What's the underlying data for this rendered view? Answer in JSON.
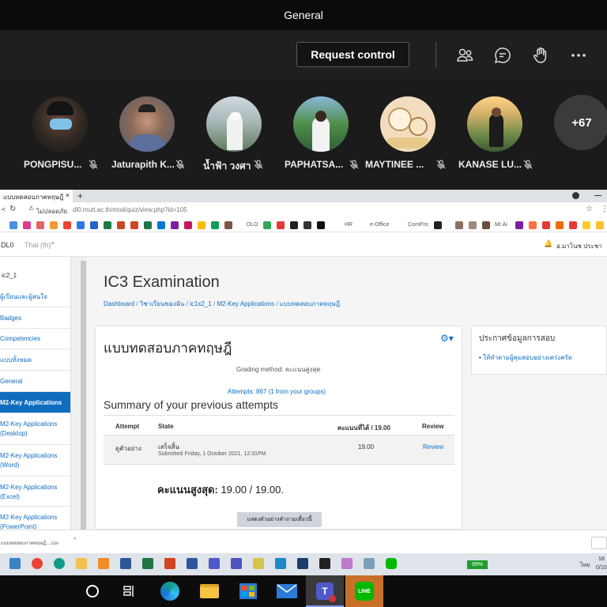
{
  "teams": {
    "title": "General",
    "request_control": "Request control",
    "participants": [
      {
        "name": "PONGPISU..."
      },
      {
        "name": "Jaturapith K..."
      },
      {
        "name": "น้ำฟ้า วงศา"
      },
      {
        "name": "PAPHATSA..."
      },
      {
        "name": "MAYTINEE ..."
      },
      {
        "name": "KANASE LU..."
      }
    ],
    "more_count": "+67"
  },
  "browser": {
    "tab_title": "แบบทดสอบภาคทฤษฎี",
    "new_tab": "+",
    "not_secure": "ไม่ปลอดภัย",
    "url": "dl0.mutt.ac.th/mod/quiz/view.php?id=105",
    "bookmark_labels": [
      "DLO",
      "HR",
      "e-Office",
      "ComPro",
      "Mr.Ai"
    ]
  },
  "moodle": {
    "site": "DL0",
    "language": "Thai (th)",
    "user": "อ.มาโนช ประชา",
    "course_title": "IC3 Examination",
    "breadcrumb": [
      "Dashboard",
      "วิชาเรียนของฉัน",
      "ic1x2_1",
      "M2-Key Applications",
      "แบบทดสอบภาคทฤษฎี"
    ],
    "sidebar": [
      "ic2_1",
      "ผู้เรียนและผู้สนใจ",
      "Badges",
      "Competencies",
      "แบบทั้งหมด",
      "General",
      "M2-Key Applications",
      "M2-Key Applications (Desktop)",
      "M2-Key Applications (Word)",
      "M2-Key Applications (Excel)",
      "M2-Key Applications (PowerPoint)"
    ],
    "quiz_title": "แบบทดสอบภาคทฤษฎี",
    "grading_method": "Grading method: คะแนนสูงสุด",
    "attempts": "Attempts: 867 (1 from your groups)",
    "summary_title": "Summary of your previous attempts",
    "table_headers": [
      "Attempt",
      "State",
      "คะแนนที่ได้ / 19.00",
      "Review"
    ],
    "row": {
      "attempt": "ดูตัวอย่าง",
      "state": "เสร็จสิ้น",
      "submitted": "Submitted Friday, 1 October 2021, 12:31PM",
      "grade": "19.00",
      "review": "Review"
    },
    "highest_grade_label": "คะแนนสูงสุด:",
    "highest_grade_value": "19.00 / 19.00.",
    "preview_button": "แสดงตัวอย่างคำถามเดี๋ยวนี้",
    "announcement_title": "ประกาศข้อมูลการสอบ",
    "announcement_item": "ให้ทำตามผู้คุมสอบอย่างเคร่งครัด"
  },
  "downloads": {
    "item": "แบบทดสอบภาคทฤษฎี....csv"
  },
  "tray": {
    "battery": "99%",
    "time": "18",
    "date": "0/10",
    "lang": "ไทย"
  },
  "colors": {
    "moodle_blue": "#0f6cbf",
    "teams_bg": "#1f1f1f",
    "battery_green": "#1f9d2c"
  }
}
